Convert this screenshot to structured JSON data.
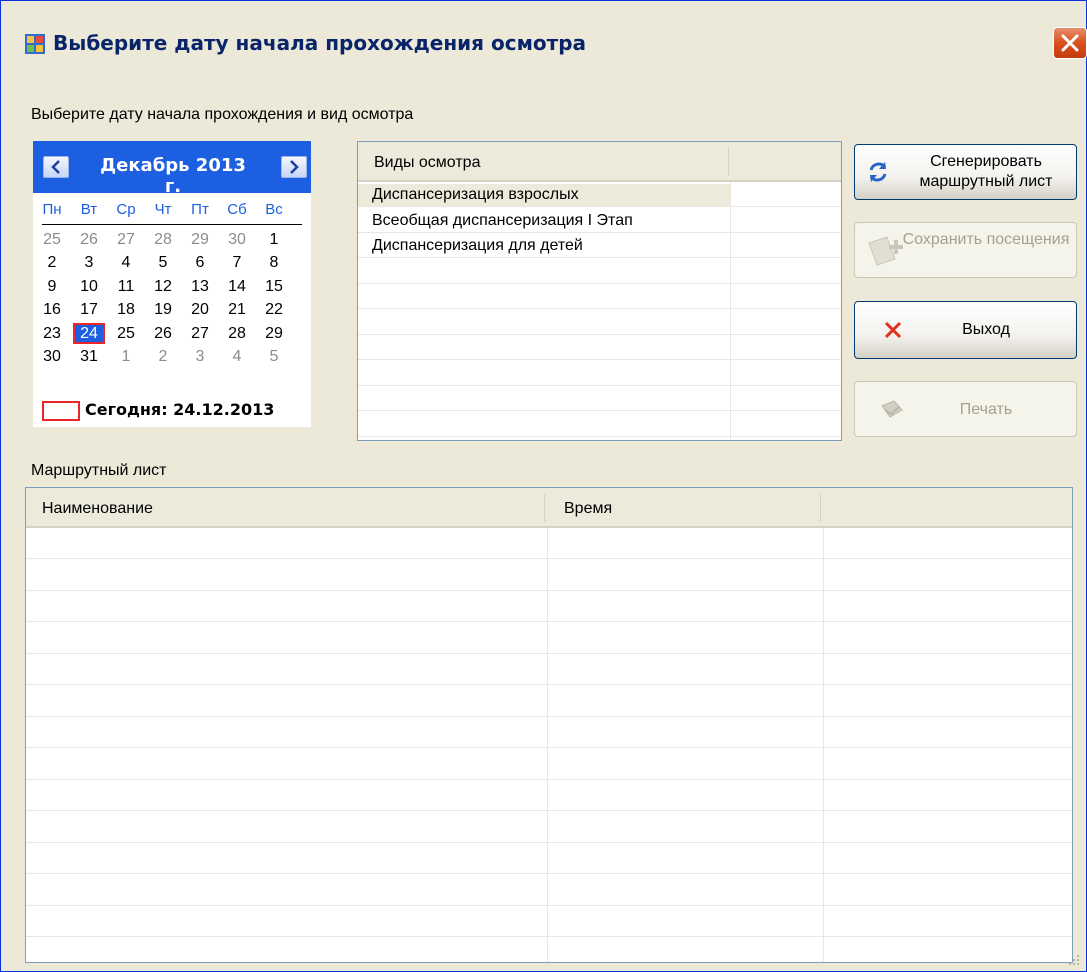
{
  "window": {
    "title": "Выберите дату начала прохождения осмотра",
    "instruction": "Выберите дату начала прохождения и вид осмотра"
  },
  "calendar": {
    "month_label": "Декабрь 2013 г.",
    "weekdays": [
      "Пн",
      "Вт",
      "Ср",
      "Чт",
      "Пт",
      "Сб",
      "Вс"
    ],
    "weeks": [
      [
        "25",
        "26",
        "27",
        "28",
        "29",
        "30",
        "1"
      ],
      [
        "2",
        "3",
        "4",
        "5",
        "6",
        "7",
        "8"
      ],
      [
        "9",
        "10",
        "11",
        "12",
        "13",
        "14",
        "15"
      ],
      [
        "16",
        "17",
        "18",
        "19",
        "20",
        "21",
        "22"
      ],
      [
        "23",
        "24",
        "25",
        "26",
        "27",
        "28",
        "29"
      ],
      [
        "30",
        "31",
        "1",
        "2",
        "3",
        "4",
        "5"
      ]
    ],
    "selected_day": "24",
    "today_label": "Сегодня: 24.12.2013",
    "accent_color": "#1C5FE0",
    "today_marker_color": "#E8262B"
  },
  "types": {
    "header": "Виды осмотра",
    "rows": [
      "Диспансеризация взрослых",
      "Всеобщая диспансеризация I Этап",
      "Диспансеризация для детей"
    ]
  },
  "buttons": {
    "generate": "Сгенерировать маршрутный лист",
    "save": "Сохранить посещения",
    "exit": "Выход",
    "print": "Печать"
  },
  "route": {
    "label": "Маршрутный лист",
    "col_name": "Наименование",
    "col_time": "Время"
  }
}
